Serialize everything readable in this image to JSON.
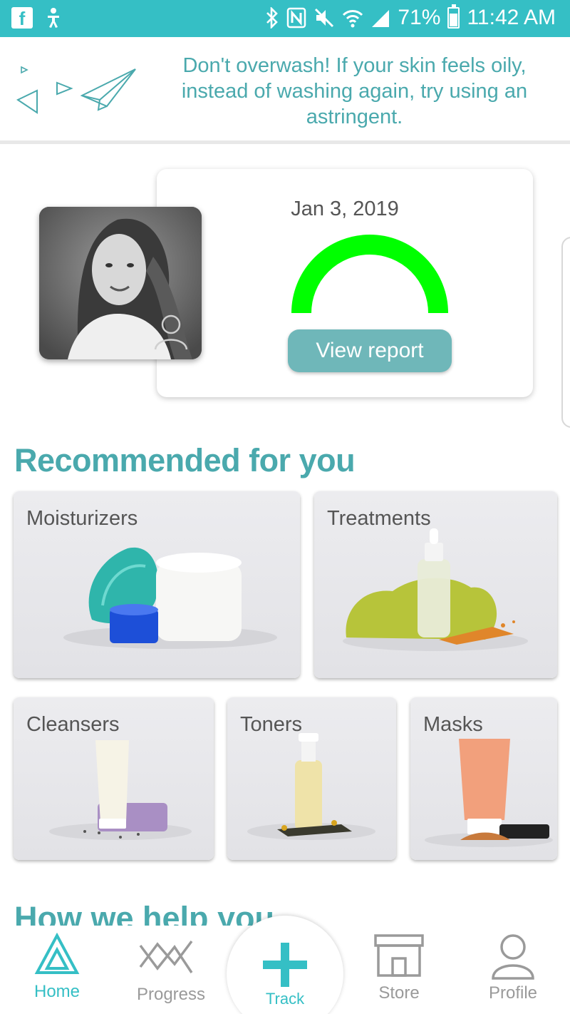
{
  "status_bar": {
    "battery": "71%",
    "time": "11:42 AM",
    "icons": [
      "facebook-icon",
      "accessibility-icon",
      "bluetooth-icon",
      "nfc-icon",
      "mute-icon",
      "wifi-icon",
      "signal-icon",
      "battery-icon"
    ]
  },
  "tip": {
    "text": "Don't overwash! If your skin feels oily, instead of washing again, try using an astringent."
  },
  "report": {
    "date": "Jan 3, 2019",
    "score_fraction": 1.0,
    "gauge_color": "#00ff00",
    "button_label": "View report"
  },
  "recommended": {
    "title": "Recommended for you",
    "tiles": [
      {
        "label": "Moisturizers"
      },
      {
        "label": "Treatments"
      },
      {
        "label": "Cleansers"
      },
      {
        "label": "Toners"
      },
      {
        "label": "Masks"
      }
    ]
  },
  "help": {
    "title": "How we help you"
  },
  "nav": {
    "home": "Home",
    "progress": "Progress",
    "track": "Track",
    "store": "Store",
    "profile": "Profile"
  },
  "colors": {
    "brand": "#35bfc5",
    "accent_text": "#4aa9ad",
    "button": "#6fb7b9",
    "inactive": "#9a9a9a"
  }
}
